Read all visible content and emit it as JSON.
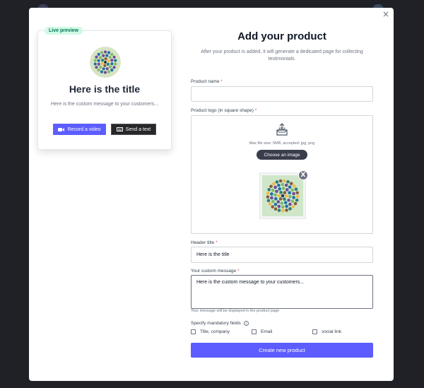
{
  "close_symbol": "×",
  "preview": {
    "badge": "Live preview",
    "title": "Here is the title",
    "message": "Here is the custom message to your customers...",
    "record_button": "Record a video",
    "text_button": "Send a text",
    "record_icon": "video-camera-icon",
    "text_icon": "keyboard-icon"
  },
  "form": {
    "title": "Add your product",
    "subtitle": "After your product is added, it will generate a dedicated page for collecting testimonials.",
    "product_name_label": "Product name",
    "product_name_value": "",
    "logo_label": "Product logo (in square shape)",
    "upload_icon": "upload-tray-icon",
    "upload_hint": "Max file size: 5MB, accepted: jpg, png",
    "choose_button": "Choose an image",
    "remove_symbol": "X",
    "header_label": "Header title",
    "header_value": "Here is the title",
    "message_label": "Your custom message",
    "message_value": "Here is the custom message to your customers...",
    "message_helper": "Your message will be displayed in the product page",
    "mandatory_label": "Specify mandatory fields",
    "info_symbol": "i",
    "required_mark": "*",
    "checkboxes": [
      "Title, company",
      "Email",
      "social link"
    ],
    "submit_button": "Create new product"
  },
  "colors": {
    "accent": "#5d5dff",
    "dark_button": "#27272a",
    "badge_bg": "#d1fae5",
    "badge_text": "#047857",
    "required": "#ef4444",
    "backdrop": "#1f2127"
  }
}
